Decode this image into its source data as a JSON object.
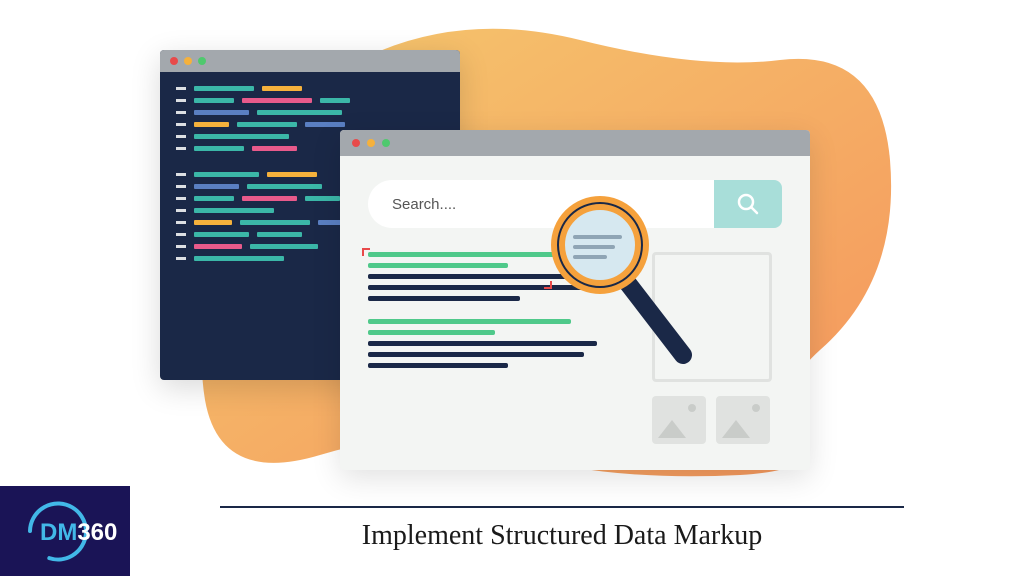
{
  "caption": "Implement Structured Data Markup",
  "search": {
    "placeholder": "Search...."
  },
  "logo": {
    "prefix": "DM",
    "suffix": "360"
  },
  "colors": {
    "blob_start": "#f5b35c",
    "blob_end": "#f59a5c",
    "code_bg": "#1a2847",
    "browser_bg": "#f3f5f3",
    "badge_bg": "#1a1456"
  }
}
